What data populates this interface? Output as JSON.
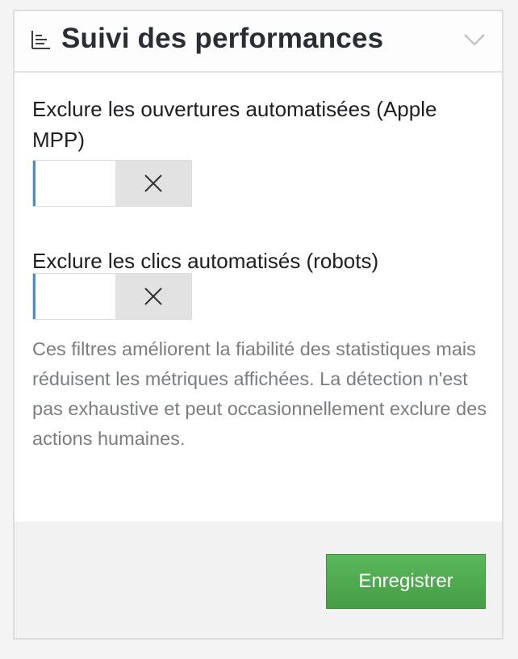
{
  "panel": {
    "title": "Suivi des performances",
    "title_icon": "bar-chart-icon",
    "collapse_icon": "chevron-down-icon"
  },
  "fields": {
    "apple_mpp": {
      "label": "Exclure les ouvertures automatisées (Apple MPP)",
      "toggle_state": "off",
      "off_icon": "close-icon"
    },
    "bots": {
      "label": "Exclure les clics automatisés (robots)",
      "toggle_state": "off",
      "off_icon": "close-icon"
    }
  },
  "help_text": "Ces filtres améliorent la fiabilité des statistiques mais réduisent les métriques affichées. La détection n'est pas exhaustive et peut occasionnellement exclure des actions humaines.",
  "footer": {
    "save_label": "Enregistrer"
  },
  "colors": {
    "save_button": "#4cae4c",
    "toggle_off_bg": "#e2e2e2",
    "focus_accent": "#4a8ec9"
  }
}
